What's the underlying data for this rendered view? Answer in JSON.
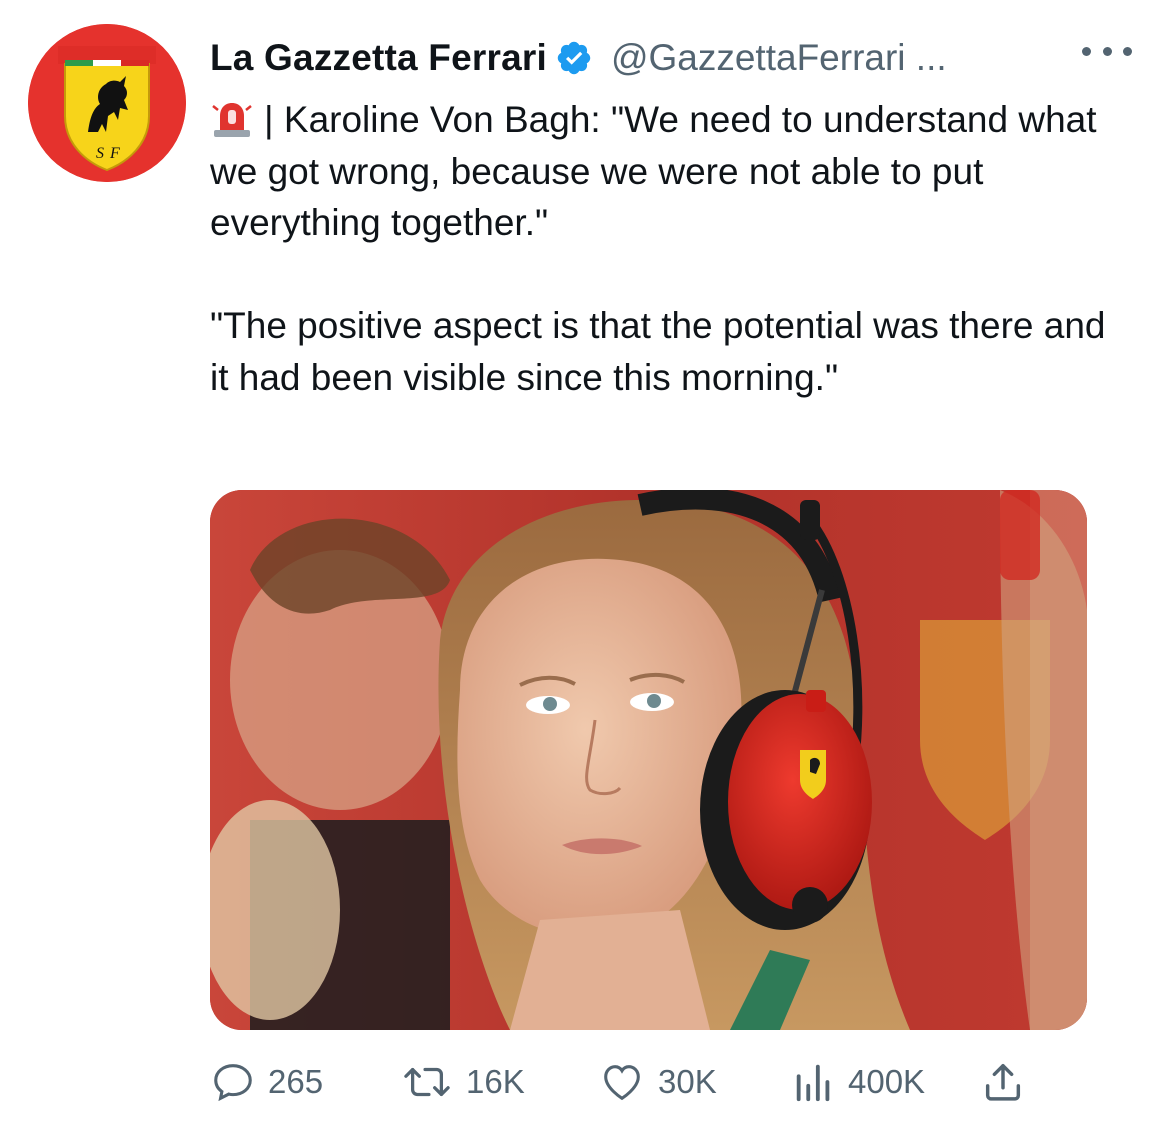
{
  "tweet": {
    "display_name": "La Gazzetta Ferrari",
    "handle": "@GazzettaFerrari ...",
    "verified": true,
    "text_line_1": "| Karoline Von Bagh: \"We need to understand what we got wrong, because we were not able to put everything together.\"",
    "text_line_2": "\"The positive aspect is that the potential was there and it had been visible since this morning.\"",
    "emoji": "siren-icon"
  },
  "avatar": {
    "logo_text": "SF",
    "background_color": "#e5322d",
    "shield_color": "#f7d41a"
  },
  "metrics": {
    "replies": "265",
    "retweets": "16K",
    "likes": "30K",
    "views": "400K"
  },
  "colors": {
    "text": "#0f1419",
    "secondary": "#536471",
    "verified": "#1d9bf0"
  },
  "icons": {
    "reply": "reply-icon",
    "retweet": "retweet-icon",
    "like": "heart-icon",
    "views": "views-icon",
    "share": "share-icon",
    "more": "more-icon"
  }
}
